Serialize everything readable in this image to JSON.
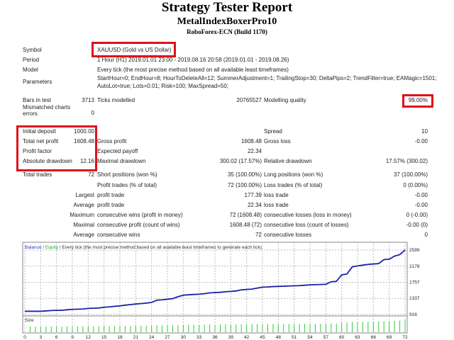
{
  "header": {
    "title": "Strategy Tester Report",
    "expert": "MetalIndexBoxerPro10",
    "broker": "RoboForex-ECN (Build 1170)"
  },
  "info": {
    "symbol_label": "Symbol",
    "symbol": "XAUUSD (Gold vs US Dollar)",
    "period_label": "Period",
    "period": "1 Hour (H1) 2019.01.01 23:00 - 2019.08.16 20:58 (2019.01.01 - 2019.08.26)",
    "model_label": "Model",
    "model": "Every tick (the most precise method based on all available least timeframes)",
    "parameters_label": "Parameters",
    "parameters_line1": "StartHour=0; EndHour=8; HourToDeleteAll=12; SummerAdjustment=1; TrailingStop=30; DeltaPips=2; TrendFilter=true; EAMagic=1501;",
    "parameters_line2": "AutoLot=true; Lots=0.01; Risk=100; MaxSpread=50;"
  },
  "stats": [
    {
      "l1": "Bars in test",
      "v1": "3713",
      "l2": "Ticks modelled",
      "v2": "20765527",
      "l3": "Modelling quality",
      "v3": "99.00%"
    },
    {
      "l1": "Mismatched charts errors",
      "v1": "0",
      "l2": "",
      "v2": "",
      "l3": "",
      "v3": ""
    },
    {
      "l1": "Initial deposit",
      "v1": "1000.00",
      "l2": "",
      "v2": "",
      "l3": "Spread",
      "v3": "10"
    },
    {
      "l1": "Total net profit",
      "v1": "1608.48",
      "l2": "Gross profit",
      "v2": "1608.48",
      "l3": "Gross loss",
      "v3": "-0.00"
    },
    {
      "l1": "Profit factor",
      "v1": "",
      "l2": "Expected payoff",
      "v2": "22.34",
      "l3": "",
      "v3": ""
    },
    {
      "l1": "Absolute drawdown",
      "v1": "12.16",
      "l2": "Maximal drawdown",
      "v2": "300.02 (17.57%)",
      "l3": "Relative drawdown",
      "v3": "17.57% (300.02)"
    },
    {
      "l1": "Total trades",
      "v1": "72",
      "l2": "Short positions (won %)",
      "v2": "35 (100.00%)",
      "l3": "Long positions (won %)",
      "v3": "37 (100.00%)"
    },
    {
      "l1": "",
      "v1": "",
      "l2": "Profit trades (% of total)",
      "v2": "72 (100.00%)",
      "l3": "Loss trades (% of total)",
      "v3": "0 (0.00%)"
    },
    {
      "l1": "",
      "v1": "Largest",
      "l2": "profit trade",
      "v2": "177.39",
      "l3": "loss trade",
      "v3": "-0.00"
    },
    {
      "l1": "",
      "v1": "Average",
      "l2": "profit trade",
      "v2": "22.34",
      "l3": "loss trade",
      "v3": "-0.00"
    },
    {
      "l1": "",
      "v1": "Maximum",
      "l2": "consecutive wins (profit in money)",
      "v2": "72 (1608.48)",
      "l3": "consecutive losses (loss in money)",
      "v3": "0 (-0.00)"
    },
    {
      "l1": "",
      "v1": "Maximal",
      "l2": "consecutive profit (count of wins)",
      "v2": "1608.48 (72)",
      "l3": "consecutive loss (count of losses)",
      "v3": "-0.00 (0)"
    },
    {
      "l1": "",
      "v1": "Average",
      "l2": "consecutive wins",
      "v2": "72",
      "l3": "consecutive losses",
      "v3": "0"
    }
  ],
  "chart_data": {
    "type": "line",
    "legend_balance": "Balance",
    "legend_sep": " / ",
    "legend_equity": "Equity",
    "legend_desc": " / Every tick (the most precise method based on all available least timeframes to generate each tick)",
    "size_label": "Size",
    "y_ticks": [
      916,
      1337,
      1757,
      2178,
      2599
    ],
    "x_ticks": [
      0,
      3,
      6,
      9,
      12,
      15,
      18,
      21,
      24,
      27,
      30,
      33,
      36,
      39,
      42,
      45,
      48,
      51,
      54,
      57,
      60,
      63,
      66,
      69,
      72
    ],
    "ylim": [
      916,
      2650
    ],
    "xlim": [
      0,
      72
    ],
    "colors": {
      "balance": "#1f1fa8",
      "equity": "#22aa22",
      "size": "#33cc33"
    },
    "balance": [
      1000,
      1000,
      1000,
      1000,
      1010,
      1020,
      1025,
      1025,
      1040,
      1050,
      1055,
      1060,
      1075,
      1080,
      1085,
      1105,
      1115,
      1130,
      1140,
      1160,
      1175,
      1190,
      1200,
      1215,
      1230,
      1290,
      1300,
      1315,
      1330,
      1380,
      1420,
      1430,
      1440,
      1445,
      1460,
      1480,
      1490,
      1495,
      1510,
      1520,
      1530,
      1560,
      1570,
      1580,
      1605,
      1630,
      1635,
      1645,
      1650,
      1655,
      1660,
      1665,
      1670,
      1680,
      1690,
      1695,
      1700,
      1705,
      1770,
      1780,
      1950,
      1975,
      2160,
      2185,
      2205,
      2225,
      2235,
      2245,
      2350,
      2360,
      2440,
      2480,
      2600
    ]
  }
}
